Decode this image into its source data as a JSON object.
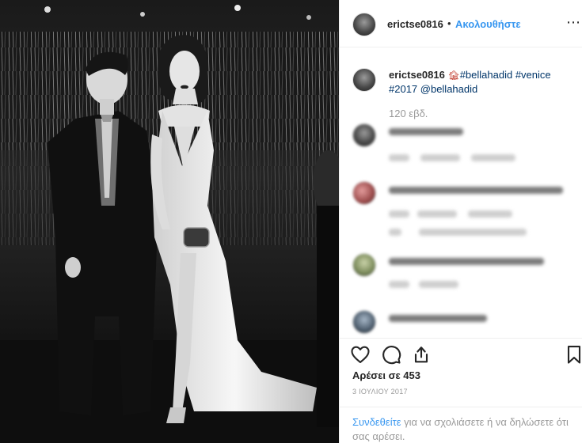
{
  "post": {
    "username": "erictse0816",
    "header_dot": "•",
    "follow_label": "Ακολουθήστε",
    "more_icon": "⋯"
  },
  "caption": {
    "username": "erictse0816",
    "emoji": "🏚",
    "text_part1": "#bellahadid #venice",
    "text_part2": "#2017 @bellahadid",
    "time_ago": "120 εβδ."
  },
  "comments_note": "blurred",
  "actions": {
    "like_icon": "heart-icon",
    "comment_icon": "comment-icon",
    "share_icon": "share-icon",
    "save_icon": "bookmark-icon"
  },
  "likes_text": "Αρέσει σε 453",
  "date_text": "3 ΙΟΥΛΙΟΥ 2017",
  "login": {
    "link": "Συνδεθείτε",
    "rest": " για να σχολιάσετε ή να δηλώσετε ότι σας αρέσει."
  },
  "colors": {
    "accent": "#3897f0",
    "hashtag": "#003569",
    "muted": "#999999"
  }
}
